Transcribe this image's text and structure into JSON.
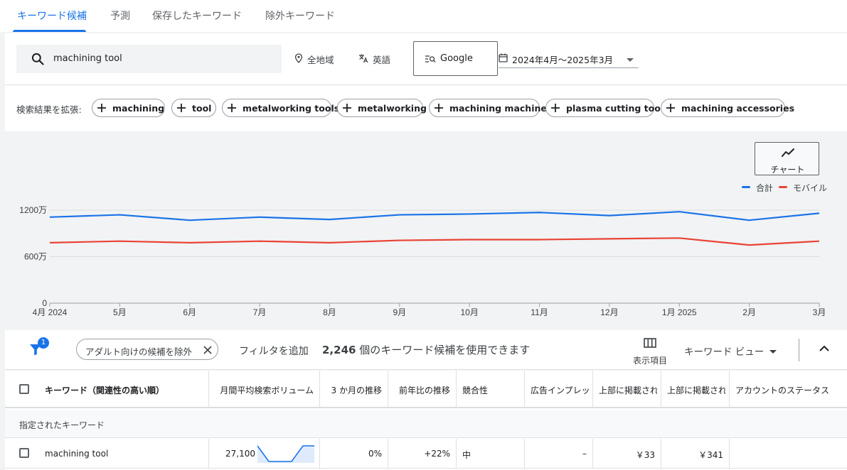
{
  "tabs": [
    {
      "label": "キーワード候補",
      "active": true
    },
    {
      "label": "予測"
    },
    {
      "label": "保存したキーワード"
    },
    {
      "label": "除外キーワード"
    }
  ],
  "search": {
    "query": "machining tool",
    "location": "全地域",
    "language": "英語",
    "network": "Google",
    "date_range": "2024年4月～2025年3月"
  },
  "expand": {
    "label": "検索結果を拡張:",
    "chips": [
      "machining",
      "tool",
      "metalworking tools",
      "metalworking",
      "machining machine",
      "plasma cutting tool",
      "machining accessories"
    ]
  },
  "chart_button_label": "チャート",
  "chart_data": {
    "type": "line",
    "categories": [
      "4月 2024",
      "5月",
      "6月",
      "7月",
      "8月",
      "9月",
      "10月",
      "11月",
      "12月",
      "1月 2025",
      "2月",
      "3月"
    ],
    "series": [
      {
        "name": "合計",
        "color": "#1a73e8",
        "values": [
          11100000,
          11400000,
          10700000,
          11100000,
          10800000,
          11400000,
          11500000,
          11700000,
          11300000,
          11800000,
          10700000,
          11600000
        ]
      },
      {
        "name": "モバイル",
        "color": "#ea4335",
        "values": [
          7800000,
          8000000,
          7800000,
          8000000,
          7800000,
          8100000,
          8200000,
          8200000,
          8300000,
          8400000,
          7500000,
          8000000
        ]
      }
    ],
    "yticks": [
      {
        "value": 0,
        "label": "0"
      },
      {
        "value": 6000000,
        "label": "600万"
      },
      {
        "value": 12000000,
        "label": "1200万"
      }
    ],
    "ylim": [
      0,
      12000000
    ],
    "grid": true,
    "legend": "top-right"
  },
  "toolbar": {
    "filter_badge": "1",
    "adult_chip": "アダルト向けの候補を除外",
    "add_filter": "フィルタを追加",
    "available_count": "2,246",
    "available_text": "個のキーワード候補を使用できます",
    "columns_label": "表示項目",
    "view_label": "キーワード ビュー"
  },
  "table": {
    "headers": [
      "キーワード（関連性の高い順）",
      "月間平均検索ボリューム",
      "3 か月の推移",
      "前年比の推移",
      "競合性",
      "広告インプレッション",
      "上部に掲載された広告の入札単価（低額帯）",
      "上部に掲載された広告の入札単価（高額帯）",
      "アカウントのステータス"
    ],
    "section_label": "指定されたキーワード",
    "rows": [
      {
        "keyword": "machining tool",
        "volume": "27,100",
        "trend_values": [
          1,
          0,
          0,
          0,
          1,
          1
        ],
        "three_month": "0%",
        "yoy": "+22%",
        "competition": "中",
        "impression": "–",
        "bid_low": "￥33",
        "bid_high": "￥341",
        "status": ""
      }
    ]
  }
}
